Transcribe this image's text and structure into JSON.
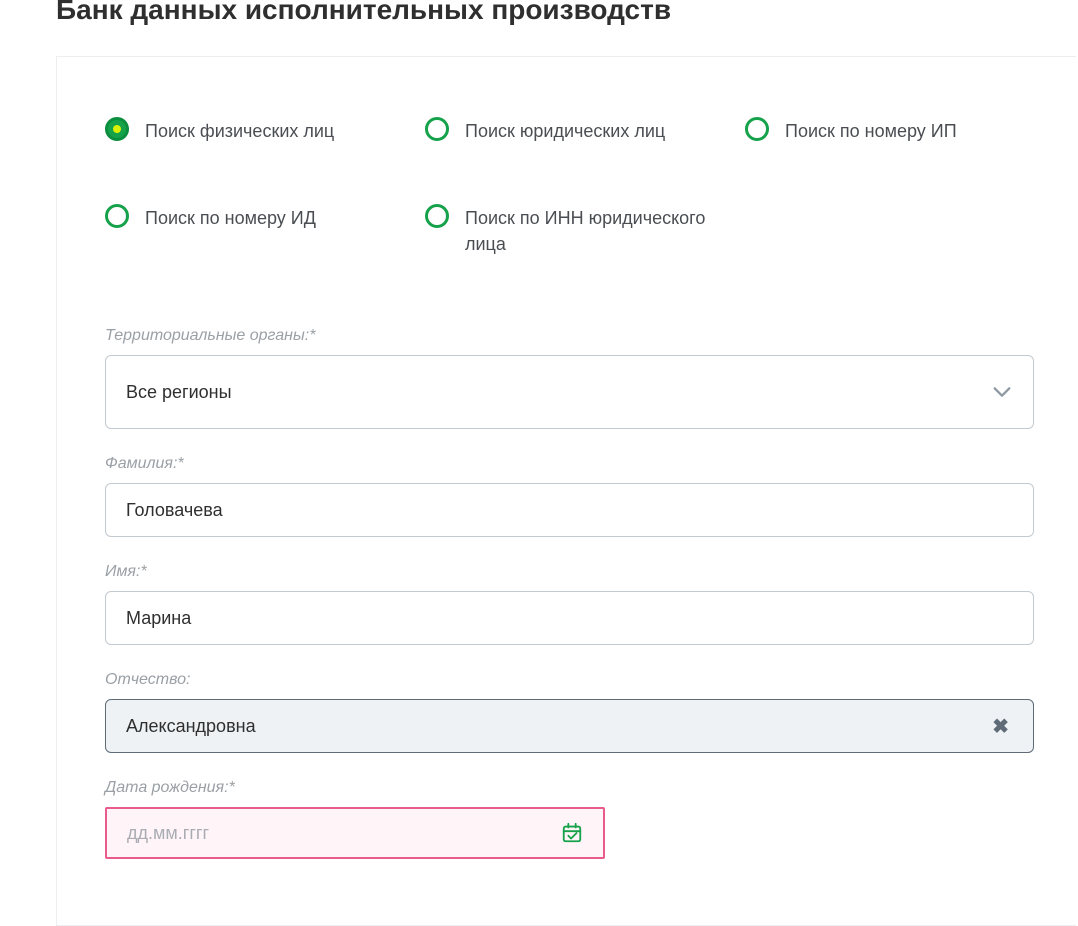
{
  "page": {
    "title": "Банк данных исполнительных производств"
  },
  "searchTypes": [
    {
      "label": "Поиск физических лиц",
      "checked": true
    },
    {
      "label": "Поиск юридических лиц",
      "checked": false
    },
    {
      "label": "Поиск по номеру ИП",
      "checked": false
    },
    {
      "label": "Поиск по номеру ИД",
      "checked": false
    },
    {
      "label": "Поиск по ИНН юридического лица",
      "checked": false
    }
  ],
  "fields": {
    "region": {
      "label": "Территориальные органы:*",
      "value": "Все регионы"
    },
    "lastname": {
      "label": "Фамилия:*",
      "value": "Головачева"
    },
    "firstname": {
      "label": "Имя:*",
      "value": "Марина"
    },
    "patronymic": {
      "label": "Отчество:",
      "value": "Александровна"
    },
    "birthdate": {
      "label": "Дата рождения:*",
      "placeholder": "дд.мм.гггг"
    }
  }
}
